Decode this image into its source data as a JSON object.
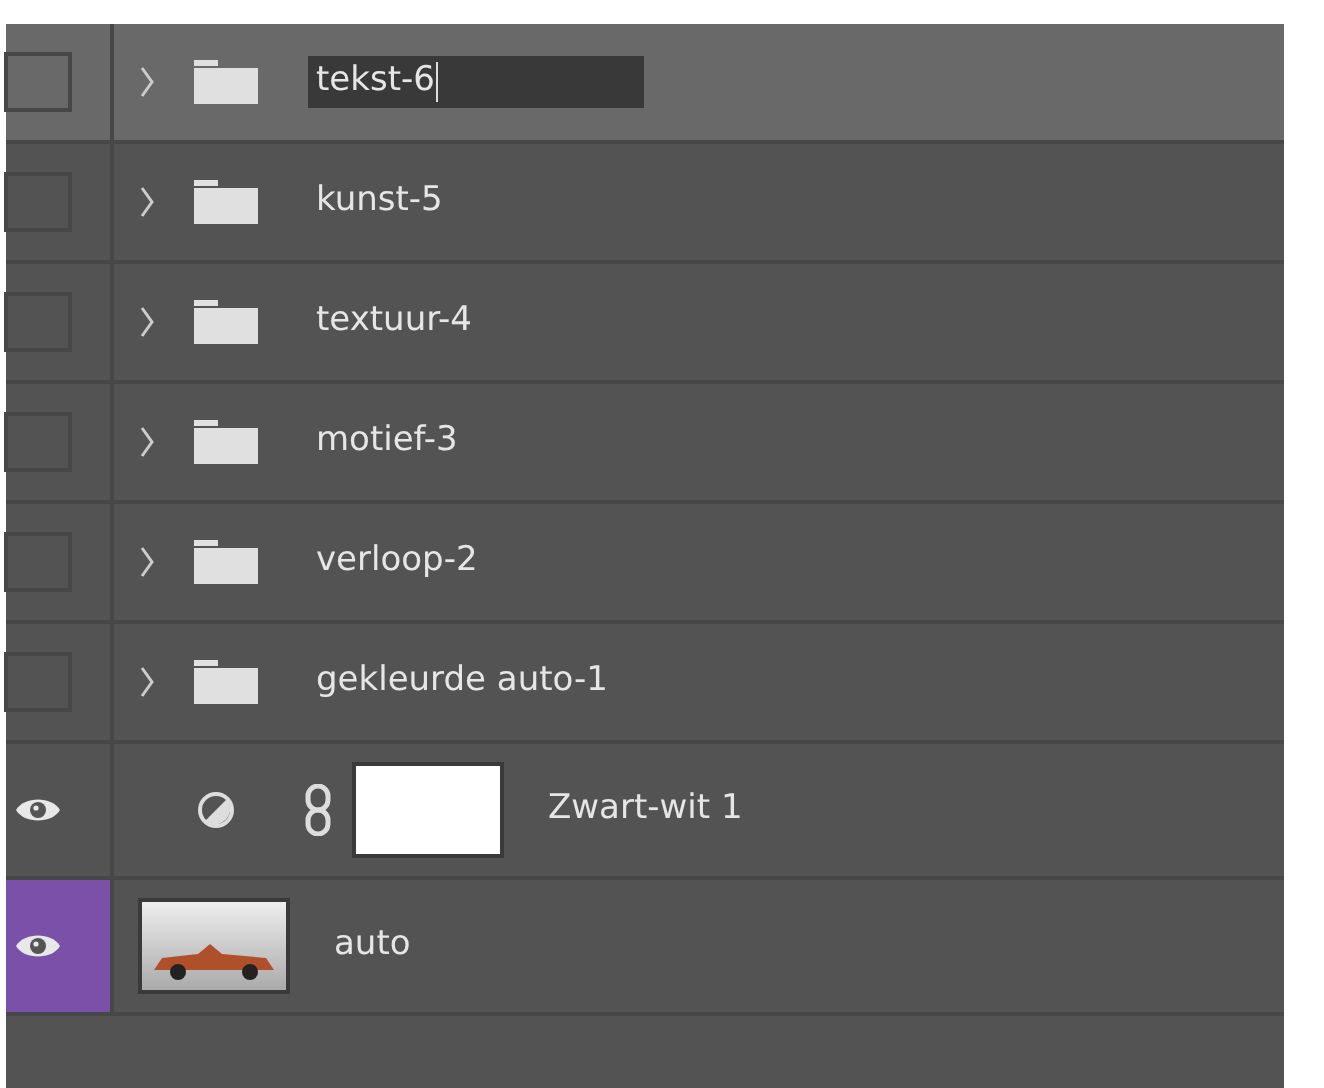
{
  "layers": [
    {
      "kind": "group",
      "name": "tekst-6",
      "visible": false,
      "selected": true,
      "editing": true
    },
    {
      "kind": "group",
      "name": "kunst-5",
      "visible": false,
      "selected": false,
      "editing": false
    },
    {
      "kind": "group",
      "name": "textuur-4",
      "visible": false,
      "selected": false,
      "editing": false
    },
    {
      "kind": "group",
      "name": "motief-3",
      "visible": false,
      "selected": false,
      "editing": false
    },
    {
      "kind": "group",
      "name": "verloop-2",
      "visible": false,
      "selected": false,
      "editing": false
    },
    {
      "kind": "group",
      "name": "gekleurde auto-1",
      "visible": false,
      "selected": false,
      "editing": false
    },
    {
      "kind": "adjustment",
      "name": "Zwart-wit 1",
      "visible": true,
      "selected": false,
      "editing": false
    },
    {
      "kind": "pixel",
      "name": "auto",
      "visible": true,
      "selected": false,
      "editing": false,
      "color": "#7a50a8"
    }
  ]
}
